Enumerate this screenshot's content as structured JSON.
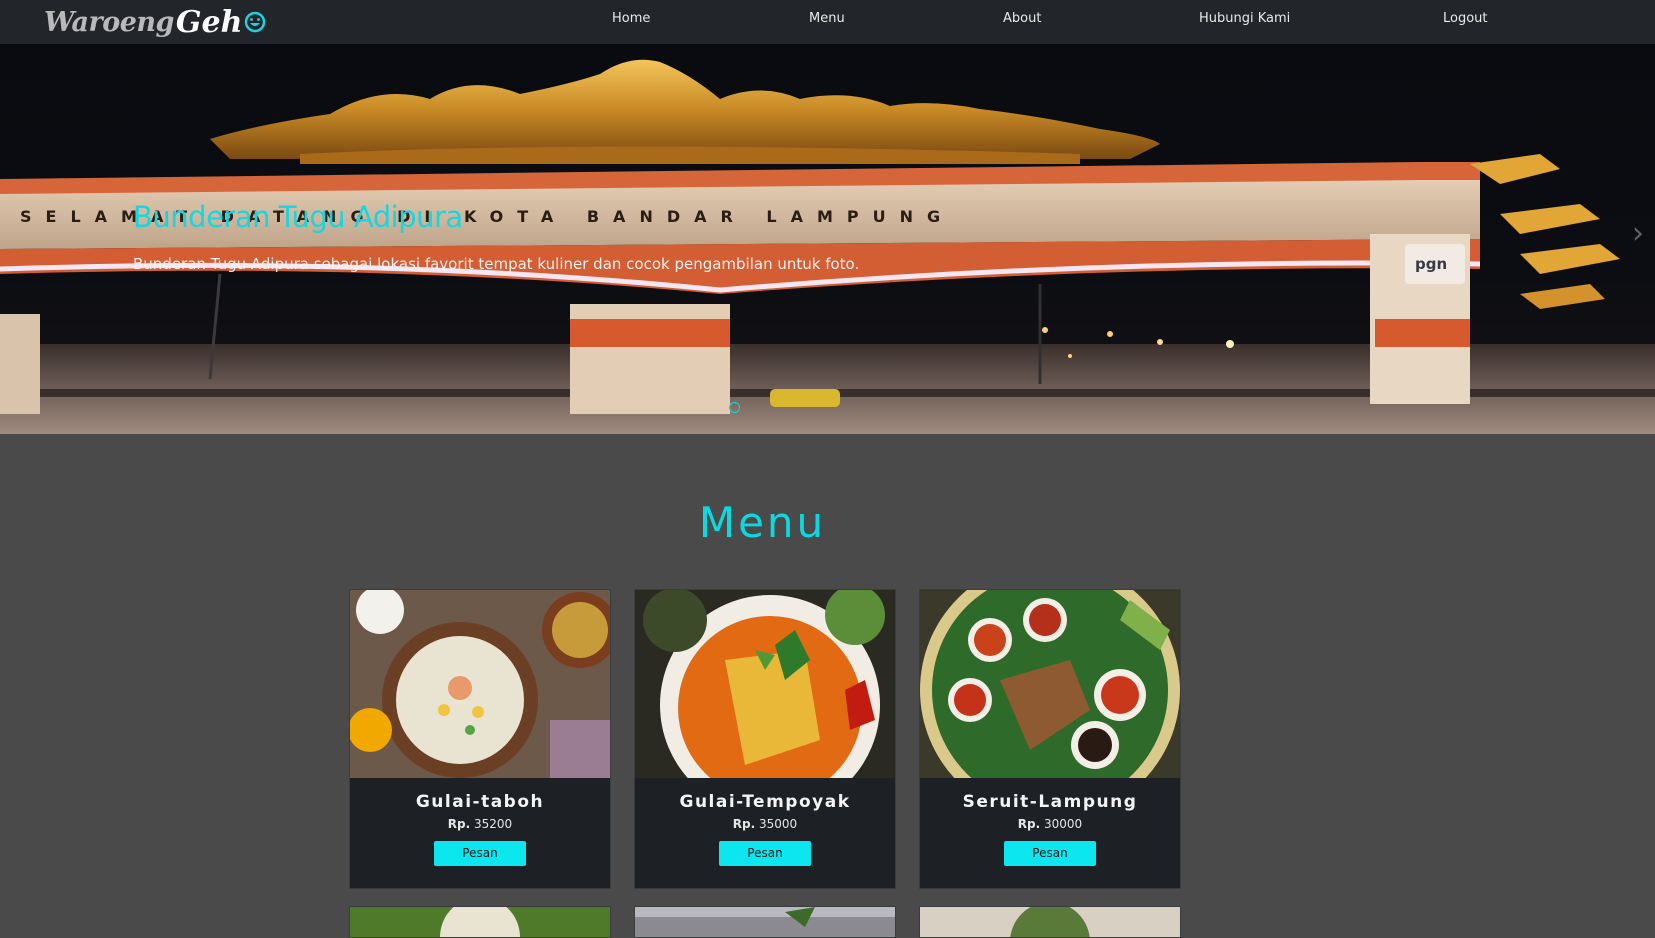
{
  "brand": {
    "part1": "Waroeng",
    "part2": "Geh"
  },
  "nav": [
    {
      "label": "Home"
    },
    {
      "label": "Menu"
    },
    {
      "label": "About"
    },
    {
      "label": "Hubungi Kami"
    },
    {
      "label": "Logout"
    }
  ],
  "hero": {
    "title": "Bunderan Tugu Adipura",
    "text": "Bunderan Tugu Adipura sebagai lokasi favorit tempat kuliner dan cocok pengambilan untuk foto.",
    "gate_text": "SELAMAT DATANG DI KOTA BANDAR LAMPUNG",
    "sign_text": "pgn"
  },
  "menu": {
    "heading": "Menu",
    "price_prefix": "Rp.",
    "items": [
      {
        "name": "Gulai-taboh",
        "price": "35200",
        "button": "Pesan"
      },
      {
        "name": "Gulai-Tempoyak",
        "price": "35000",
        "button": "Pesan"
      },
      {
        "name": "Seruit-Lampung",
        "price": "30000",
        "button": "Pesan"
      }
    ]
  },
  "colors": {
    "accent": "#0ce6ee",
    "navbar": "#22252a",
    "page": "#4a4a4a",
    "card": "#1d2024"
  }
}
